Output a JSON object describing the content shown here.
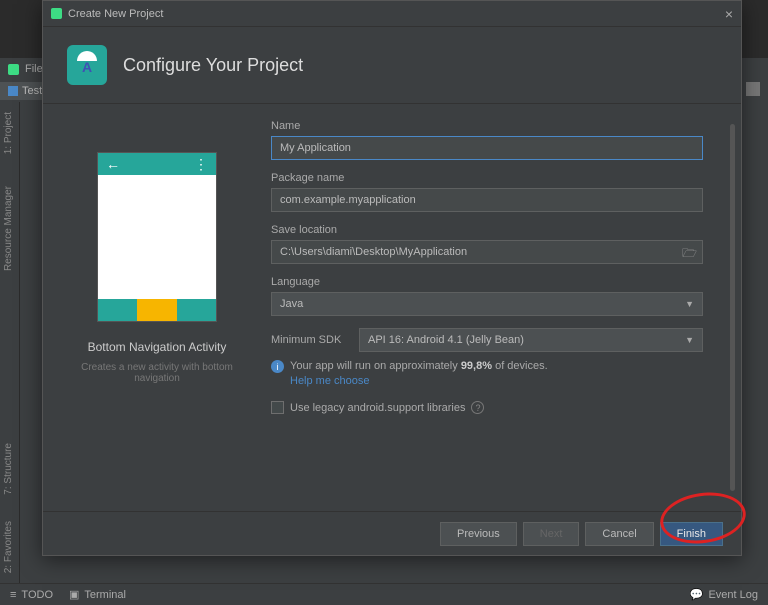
{
  "ide": {
    "menubar_file": "File",
    "tab_name": "Test",
    "side_project": "1: Project",
    "side_resmgr": "Resource Manager",
    "side_structure": "7: Structure",
    "side_favorites": "2: Favorites",
    "status_todo": "TODO",
    "status_terminal": "Terminal",
    "status_eventlog": "Event Log"
  },
  "dialog": {
    "window_title": "Create New Project",
    "heading": "Configure Your Project",
    "preview_title": "Bottom Navigation Activity",
    "preview_subtitle": "Creates a new activity with bottom navigation",
    "form": {
      "name_label": "Name",
      "name_value": "My Application",
      "package_label": "Package name",
      "package_value": "com.example.myapplication",
      "save_label": "Save location",
      "save_value": "C:\\Users\\diami\\Desktop\\MyApplication",
      "language_label": "Language",
      "language_value": "Java",
      "minsdk_label": "Minimum SDK",
      "minsdk_value": "API 16: Android 4.1 (Jelly Bean)",
      "info_text_prefix": "Your app will run on approximately ",
      "info_text_pct": "99,8%",
      "info_text_suffix": " of devices.",
      "help_link": "Help me choose",
      "legacy_label": "Use legacy android.support libraries"
    },
    "buttons": {
      "previous": "Previous",
      "next": "Next",
      "cancel": "Cancel",
      "finish": "Finish"
    }
  }
}
